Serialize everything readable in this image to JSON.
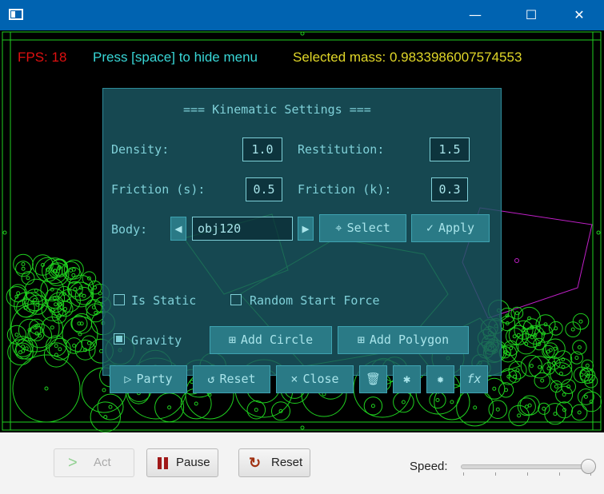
{
  "window": {
    "title_buttons": {
      "minimize": "—",
      "maximize": "☐",
      "close": "✕"
    }
  },
  "hud": {
    "fps": "FPS: 18",
    "hint": "Press [space] to hide menu",
    "selected_mass": "Selected mass: 0.9833986007574553",
    "colors": {
      "fps": "#e01010",
      "hint": "#38d6d6",
      "mass": "#e0d628"
    }
  },
  "panel": {
    "title": "=== Kinematic Settings ===",
    "density_label": "Density:",
    "density_value": "1.0",
    "restitution_label": "Restitution:",
    "restitution_value": "1.5",
    "friction_s_label": "Friction (s):",
    "friction_s_value": "0.5",
    "friction_k_label": "Friction (k):",
    "friction_k_value": "0.3",
    "body_label": "Body:",
    "body_value": "obj120",
    "select_label": "Select",
    "apply_label": "Apply",
    "is_static_label": "Is Static",
    "is_static_checked": false,
    "random_force_label": "Random Start Force",
    "random_force_checked": false,
    "gravity_label": "Gravity",
    "gravity_checked": true,
    "add_circle_label": "Add Circle",
    "add_polygon_label": "Add Polygon",
    "party_label": "Party",
    "reset_label": "Reset",
    "close_label": "Close",
    "fx_label": "fx"
  },
  "controls": {
    "act_label": "Act",
    "act_enabled": false,
    "pause_label": "Pause",
    "reset_label": "Reset",
    "speed_label": "Speed:",
    "speed_value": 1.0
  },
  "colors": {
    "sim_green": "#1fd01f",
    "polygon_magenta": "#c020c8",
    "panel_bg": "#1b5863",
    "panel_text": "#7fd0d8",
    "pause_icon": "#a01818",
    "reset_icon": "#a03010"
  }
}
